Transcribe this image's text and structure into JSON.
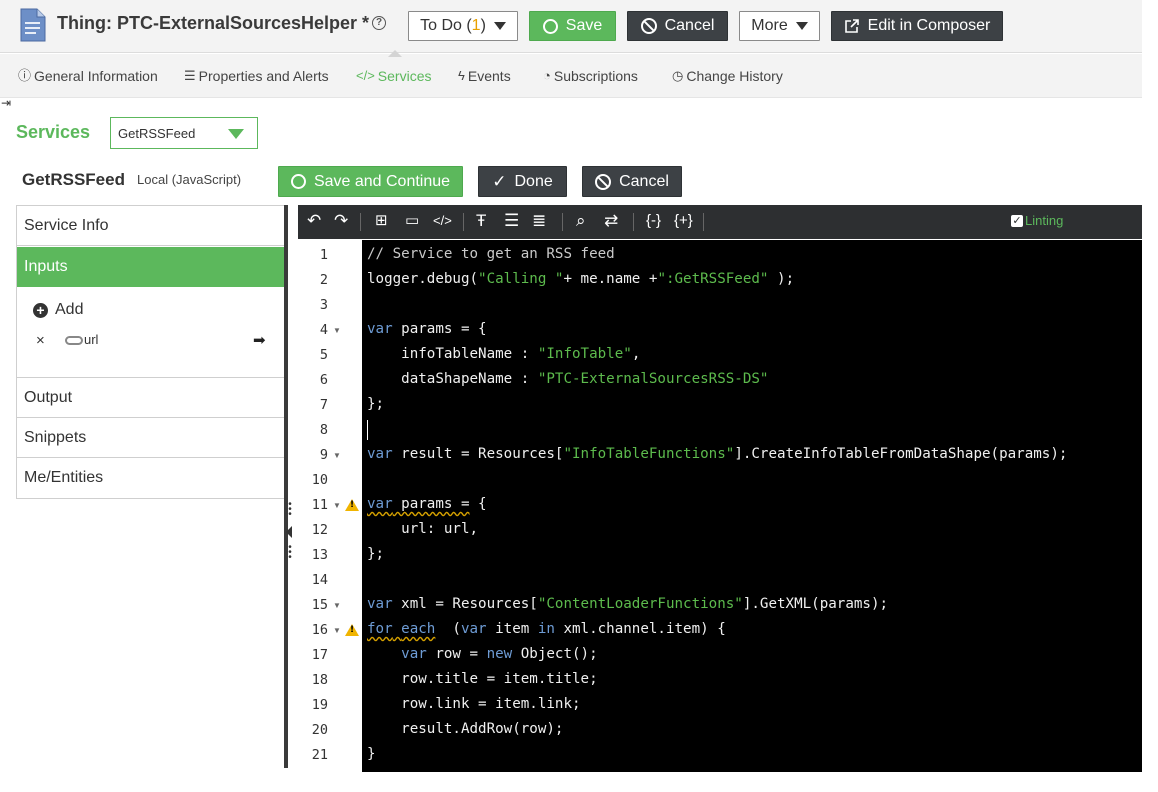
{
  "header": {
    "title": "Thing: PTC-ExternalSourcesHelper *",
    "help": "?",
    "todo_label": "To Do (",
    "todo_count": "1",
    "todo_close": ")",
    "save_label": "Save",
    "cancel_label": "Cancel",
    "more_label": "More",
    "composer_label": "Edit in Composer"
  },
  "tabs": [
    {
      "label": "General Information",
      "icon": "info-icon"
    },
    {
      "label": "Properties and Alerts",
      "icon": "list-icon"
    },
    {
      "label": "Services",
      "icon": "code-icon",
      "active": true
    },
    {
      "label": "Events",
      "icon": "lightning-icon"
    },
    {
      "label": "Subscriptions",
      "icon": "rss-icon"
    },
    {
      "label": "Change History",
      "icon": "history-icon"
    }
  ],
  "services": {
    "heading": "Services",
    "selected_service": "GetRSSFeed",
    "service_name": "GetRSSFeed",
    "service_type": "Local (JavaScript)",
    "save_continue_label": "Save and Continue",
    "done_label": "Done",
    "cancel_label": "Cancel"
  },
  "left_panel": {
    "items": [
      "Service Info",
      "Inputs",
      "Output",
      "Snippets",
      "Me/Entities"
    ],
    "active": "Inputs",
    "add_label": "Add",
    "remove_symbol": "×",
    "inputs": [
      {
        "name": "url"
      }
    ]
  },
  "toolbar": {
    "linting_label": "Linting",
    "linting_checked": true
  },
  "colors": {
    "accent_green": "#5cb85c",
    "dark_button": "#3d4145",
    "editor_bg": "#000000",
    "keyword": "#6e9cd5",
    "string": "#5dbb4d",
    "warning": "#f0b400"
  },
  "code": {
    "lines": [
      "// Service to get an RSS feed",
      "logger.debug(\"Calling \"+ me.name +\":GetRSSFeed\" );",
      "",
      "var params = {",
      "    infoTableName : \"InfoTable\",",
      "    dataShapeName : \"PTC-ExternalSourcesRSS-DS\"",
      "};",
      "",
      "var result = Resources[\"InfoTableFunctions\"].CreateInfoTableFromDataShape(params);",
      "",
      "var params = {",
      "    url: url,",
      "};",
      "",
      "var xml = Resources[\"ContentLoaderFunctions\"].GetXML(params);",
      "for each  (var item in xml.channel.item) {",
      "    var row = new Object();",
      "    row.title = item.title;",
      "    row.link = item.link;",
      "    result.AddRow(row);",
      "}"
    ],
    "fold_lines": [
      4,
      9,
      11,
      15,
      16
    ],
    "warning_lines": [
      11,
      16
    ]
  }
}
